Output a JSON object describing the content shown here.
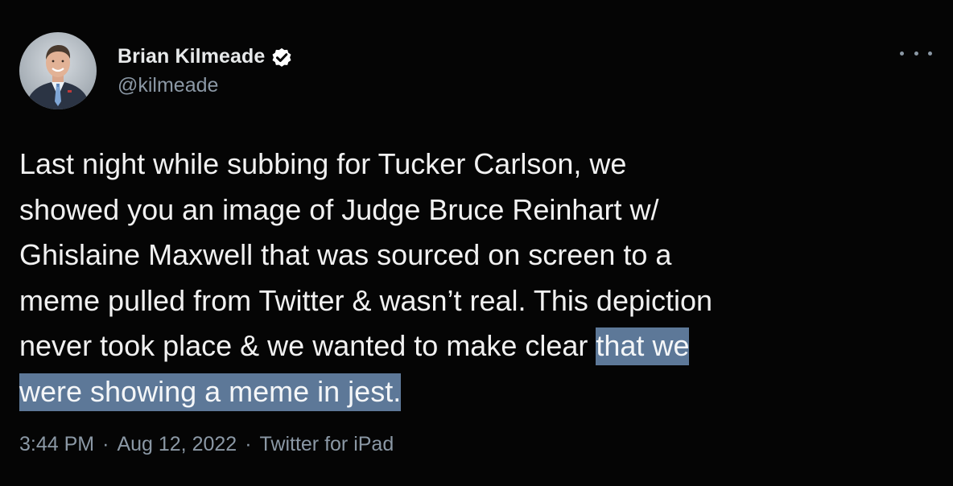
{
  "author": {
    "display_name": "Brian Kilmeade",
    "handle": "@kilmeade",
    "verified": true,
    "avatar_icon": "profile-photo"
  },
  "menu": {
    "icon": "more-options-icon"
  },
  "tweet": {
    "text_plain": "Last night while subbing for Tucker Carlson, we\nshowed you an image of Judge Bruce Reinhart w/\nGhislaine Maxwell that was sourced on screen to a\nmeme pulled from Twitter & wasn’t real. This depiction\nnever took place & we wanted to make clear ",
    "text_highlighted": "that we \nwere showing a meme in jest."
  },
  "meta": {
    "time": "3:44 PM",
    "separator": "·",
    "date": "Aug 12, 2022",
    "source": "Twitter for iPad"
  },
  "colors": {
    "background": "#050505",
    "text": "#f1f1f1",
    "secondary_text": "#8b98a5",
    "highlight": "#5d7898",
    "verified_badge": "#ffffff"
  }
}
